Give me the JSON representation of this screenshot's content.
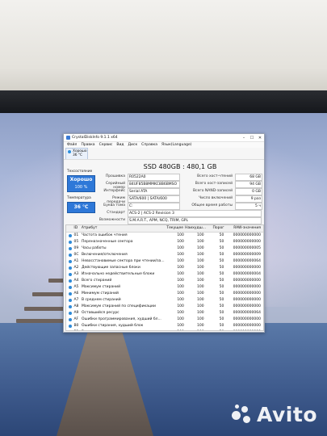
{
  "window": {
    "title": "CrystalDiskInfo 9.1.1 x64",
    "controls": [
      "–",
      "☐",
      "✕"
    ]
  },
  "menu": [
    "Файл",
    "Правка",
    "Сервис",
    "Вид",
    "Диск",
    "Справка",
    "Язык(Language)"
  ],
  "disk_tab": {
    "status": "Хорошо",
    "temp": "36 °C",
    "letter": "C:"
  },
  "disk_title": "SSD 480GB : 480,1 GB",
  "health": {
    "label": "Техсостояние",
    "status": "Хорошо",
    "percent": "100 %"
  },
  "temperature": {
    "label": "Температура",
    "value": "36 °C"
  },
  "info_left": [
    {
      "label": "Прошивка",
      "value": "R0522A0"
    },
    {
      "label": "Серийный номер",
      "value": "84UF85B8MMKC8B6BMSO"
    },
    {
      "label": "Интерфейс",
      "value": "Serial ATA"
    },
    {
      "label": "Режим передачи",
      "value": "SATA/600 | SATA/600"
    },
    {
      "label": "Буква тома",
      "value": "C:"
    }
  ],
  "info_right": [
    {
      "label": "Всего хост-чтений",
      "value": "68 GB"
    },
    {
      "label": "Всего хост-записей",
      "value": "94 GB"
    },
    {
      "label": "Всего NAND-записей",
      "value": "0 GB"
    },
    {
      "label": "Число включений",
      "value": "9 раз"
    },
    {
      "label": "Общее время работы",
      "value": "5 ч"
    }
  ],
  "info_wide": [
    {
      "label": "Стандарт",
      "value": "ACS-2 | ACS-2 Revision 3"
    },
    {
      "label": "Возможности",
      "value": "S.M.A.R.T., APM, NCQ, TRIM, GPL"
    }
  ],
  "table": {
    "headers": [
      "ID",
      "Атрибут",
      "Текущее",
      "Наихудш...",
      "Порог",
      "RAW-значения"
    ],
    "rows": [
      [
        "01",
        "Частота ошибок чтения",
        "100",
        "100",
        "50",
        "000000000000"
      ],
      [
        "05",
        "Переназначенные сектора",
        "100",
        "100",
        "50",
        "000000000000"
      ],
      [
        "09",
        "Часы работы",
        "100",
        "100",
        "50",
        "000000000005"
      ],
      [
        "0C",
        "Включения/отключения",
        "100",
        "100",
        "50",
        "000000000009"
      ],
      [
        "A1",
        "Невосстановимые сектора при чтении/за...",
        "100",
        "100",
        "50",
        "000000000064"
      ],
      [
        "A2",
        "Действующие запасные блоки",
        "100",
        "100",
        "50",
        "000000000000"
      ],
      [
        "A3",
        "Изначально недействительные блоки",
        "100",
        "100",
        "50",
        "000000000004"
      ],
      [
        "A4",
        "Всего стираний",
        "100",
        "100",
        "50",
        "000000000000"
      ],
      [
        "A5",
        "Максимум стираний",
        "100",
        "100",
        "50",
        "000000000000"
      ],
      [
        "A6",
        "Минимум стираний",
        "100",
        "100",
        "50",
        "000000000000"
      ],
      [
        "A7",
        "В среднем стираний",
        "100",
        "100",
        "50",
        "000000000000"
      ],
      [
        "A8",
        "Максимум стираний по спецификации",
        "100",
        "100",
        "50",
        "000000000000"
      ],
      [
        "A9",
        "Оставшийся ресурс",
        "100",
        "100",
        "50",
        "000000000064"
      ],
      [
        "AF",
        "Ошибки программирования, худший бл...",
        "100",
        "100",
        "50",
        "000000000000"
      ],
      [
        "B0",
        "Ошибки стирания, худший блок",
        "100",
        "100",
        "50",
        "000000000000"
      ],
      [
        "B1",
        "Выравнивание износа",
        "100",
        "100",
        "50",
        "000000000000"
      ]
    ]
  },
  "watermark": "Avito",
  "colors": {
    "status_blue": "#2e78d8",
    "dot_blue": "#2e8ad8"
  }
}
